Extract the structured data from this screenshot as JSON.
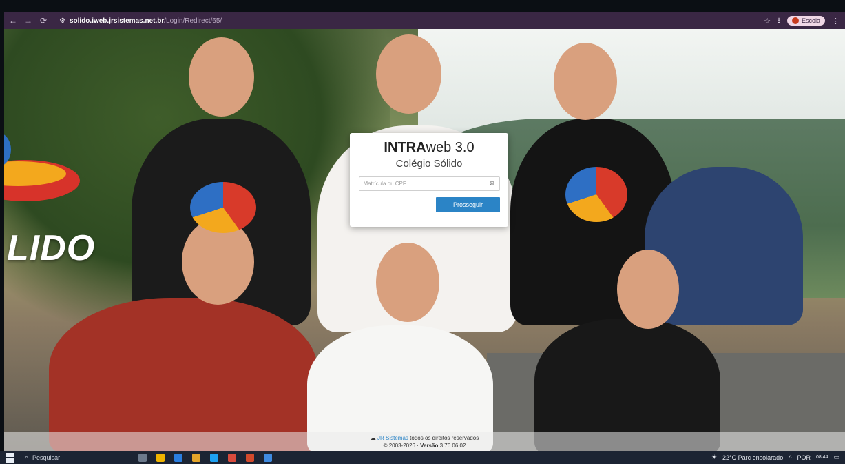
{
  "browser": {
    "url_domain": "solido.iweb.jrsistemas.net.br",
    "url_path": "/Login/Redirect/65/",
    "profile_label": "Escola"
  },
  "background": {
    "logo_text": "LIDO"
  },
  "login": {
    "title_bold": "INTRA",
    "title_rest": "web 3.0",
    "subtitle": "Colégio Sólido",
    "input_placeholder": "Matrícula ou CPF",
    "input_value": "",
    "submit_label": "Prosseguir"
  },
  "footer": {
    "company": "JR Sistemas",
    "rights_text": "todos os direitos reservados",
    "copyright": "© 2003-2026",
    "version_label": "Versão",
    "version_value": "3.76.06.02"
  },
  "taskbar": {
    "search_placeholder": "Pesquisar",
    "weather": "22°C  Parc ensolarado",
    "language": "POR",
    "time": "08:44"
  },
  "colors": {
    "browser_bar": "#3a2744",
    "accent": "#2b84c6",
    "taskbar": "#1c2433"
  },
  "icons": [
    "back-icon",
    "forward-icon",
    "reload-icon",
    "site-info-icon",
    "star-icon",
    "download-icon",
    "mail-icon",
    "windows-start-icon",
    "search-icon"
  ]
}
